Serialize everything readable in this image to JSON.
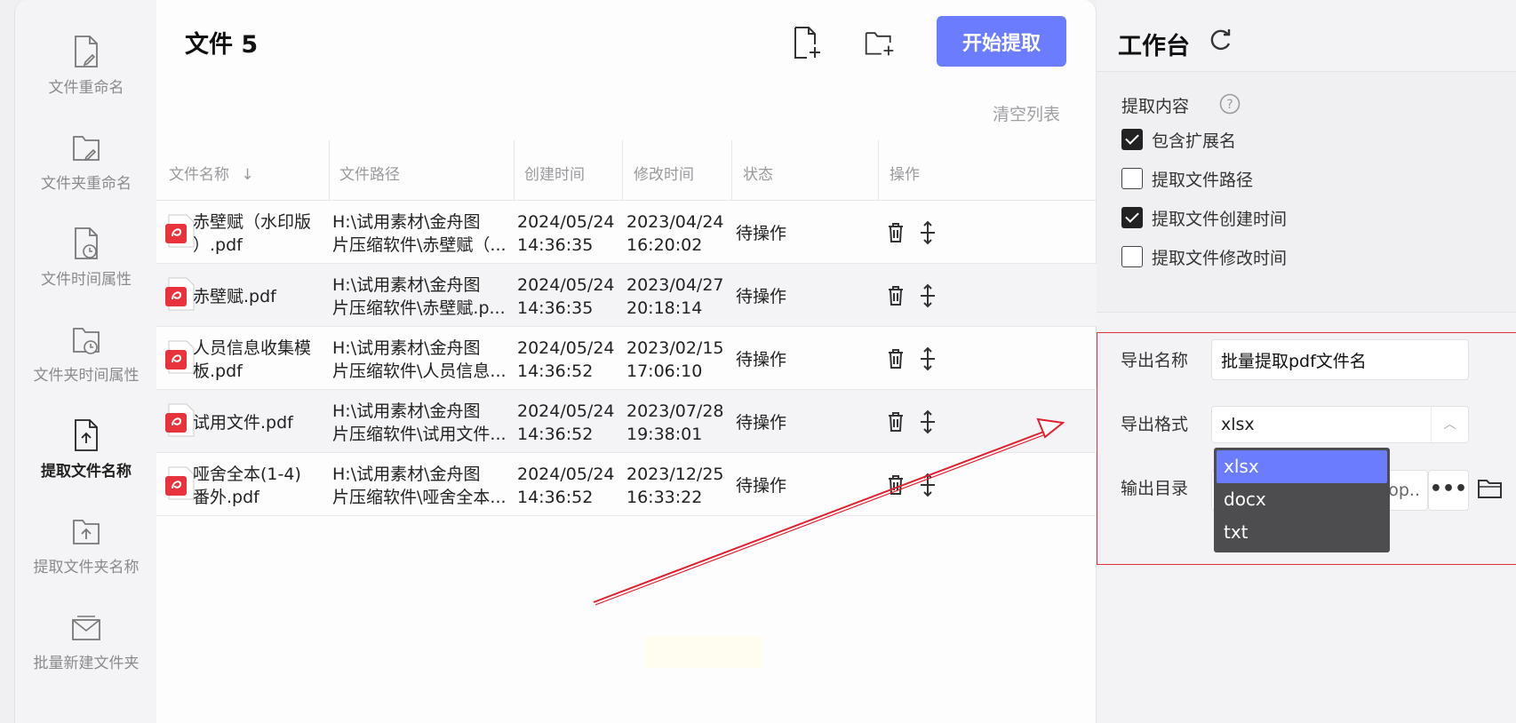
{
  "sidebar": {
    "items": [
      {
        "label": "文件重命名",
        "icon": "file-rename-icon"
      },
      {
        "label": "文件夹重命名",
        "icon": "folder-rename-icon"
      },
      {
        "label": "文件时间属性",
        "icon": "file-time-icon"
      },
      {
        "label": "文件夹时间属性",
        "icon": "folder-time-icon"
      },
      {
        "label": "提取文件名称",
        "icon": "file-extract-icon",
        "active": true
      },
      {
        "label": "提取文件夹名称",
        "icon": "folder-extract-icon"
      },
      {
        "label": "批量新建文件夹",
        "icon": "batch-folder-icon"
      }
    ]
  },
  "main": {
    "title": "文件 5",
    "start_button": "开始提取",
    "clear_list": "清空列表",
    "columns": [
      "文件名称",
      "文件路径",
      "创建时间",
      "修改时间",
      "状态",
      "操作"
    ],
    "rows": [
      {
        "name": [
          "赤壁赋（水印版",
          "）.pdf"
        ],
        "path": [
          "H:\\试用素材\\金舟图",
          "片压缩软件\\赤壁赋（..."
        ],
        "created": [
          "2024/05/24",
          "14:36:35"
        ],
        "modified": [
          "2023/04/24",
          "16:20:02"
        ],
        "status": "待操作"
      },
      {
        "name": [
          "赤壁赋.pdf"
        ],
        "path": [
          "H:\\试用素材\\金舟图",
          "片压缩软件\\赤壁赋.p..."
        ],
        "created": [
          "2024/05/24",
          "14:36:35"
        ],
        "modified": [
          "2023/04/27",
          "20:18:14"
        ],
        "status": "待操作"
      },
      {
        "name": [
          "人员信息收集模",
          "板.pdf"
        ],
        "path": [
          "H:\\试用素材\\金舟图",
          "片压缩软件\\人员信息..."
        ],
        "created": [
          "2024/05/24",
          "14:36:52"
        ],
        "modified": [
          "2023/02/15",
          "17:06:10"
        ],
        "status": "待操作"
      },
      {
        "name": [
          "试用文件.pdf"
        ],
        "path": [
          "H:\\试用素材\\金舟图",
          "片压缩软件\\试用文件..."
        ],
        "created": [
          "2024/05/24",
          "14:36:52"
        ],
        "modified": [
          "2023/07/28",
          "19:38:01"
        ],
        "status": "待操作"
      },
      {
        "name": [
          "哑舍全本(1-4)",
          "番外.pdf"
        ],
        "path": [
          "H:\\试用素材\\金舟图",
          "片压缩软件\\哑舍全本..."
        ],
        "created": [
          "2024/05/24",
          "14:36:52"
        ],
        "modified": [
          "2023/12/25",
          "16:33:22"
        ],
        "status": "待操作"
      }
    ]
  },
  "workbench": {
    "title": "工作台",
    "extract_label": "提取内容",
    "options": [
      {
        "label": "包含扩展名",
        "checked": true
      },
      {
        "label": "提取文件路径",
        "checked": false
      },
      {
        "label": "提取文件创建时间",
        "checked": true
      },
      {
        "label": "提取文件修改时间",
        "checked": false
      }
    ],
    "export_name_label": "导出名称",
    "export_name_value": "批量提取pdf文件名",
    "export_format_label": "导出格式",
    "export_format_value": "xlsx",
    "output_dir_label": "输出目录",
    "output_dir_value": "op..",
    "more_label": "•••",
    "format_options": [
      "xlsx",
      "docx",
      "txt"
    ],
    "selected_format": "xlsx"
  },
  "colors": {
    "accent": "#6b7cff",
    "highlight_border": "#e03040",
    "arrow": "#e02030",
    "pdf_icon": "#e8333c"
  }
}
